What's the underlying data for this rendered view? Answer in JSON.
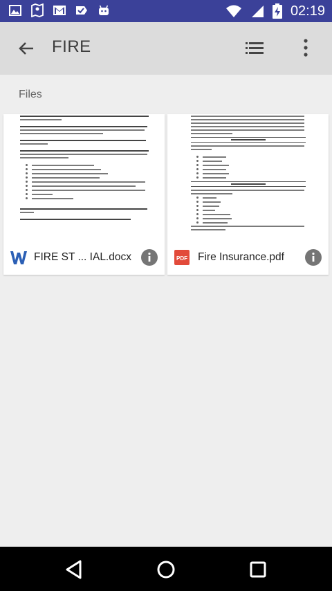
{
  "status_bar": {
    "time": "02:19",
    "left_icons": [
      "gallery-icon",
      "maps-icon",
      "gmail-icon",
      "check-icon",
      "android-icon"
    ],
    "right_icons": [
      "wifi-icon",
      "signal-icon",
      "battery-charging-icon"
    ]
  },
  "app_bar": {
    "title": "FIRE"
  },
  "files_section": {
    "label": "Files",
    "items": [
      {
        "name": "FIRE ST ... IAL.docx",
        "icon": "word-doc-icon",
        "icon_color": "#2b5fb5"
      },
      {
        "name": "Fire Insurance.pdf",
        "icon": "pdf-icon",
        "icon_color": "#e24a3a",
        "icon_text": "PDF"
      }
    ]
  },
  "colors": {
    "status_bar": "#3b4199",
    "app_bar": "#dcdcdc",
    "background": "#eeeeee"
  }
}
